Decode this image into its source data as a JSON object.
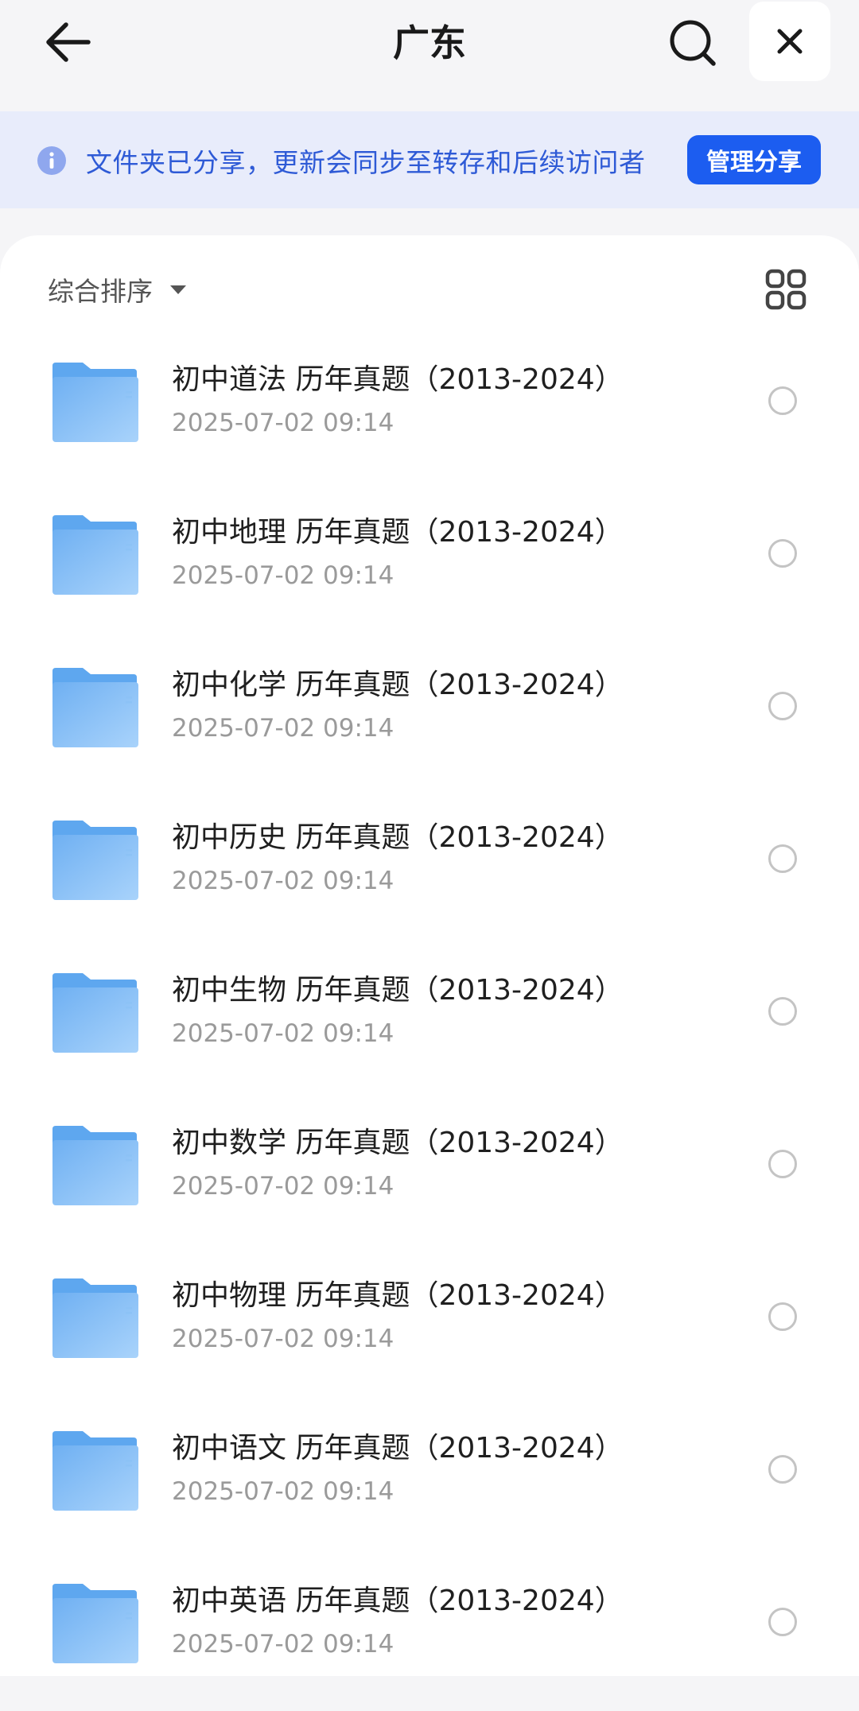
{
  "header": {
    "title": "广东",
    "back_icon": "arrow-left-icon",
    "search_icon": "search-icon",
    "close_icon": "close-icon"
  },
  "share_banner": {
    "icon": "info-icon",
    "message": "文件夹已分享，更新会同步至转存和后续访问者",
    "manage_button": "管理分享"
  },
  "toolbar": {
    "sort_label": "综合排序",
    "sort_icon": "caret-down-icon",
    "view_toggle_icon": "grid-view-icon"
  },
  "files": [
    {
      "name": "初中道法 历年真题（2013-2024）",
      "date": "2025-07-02 09:14",
      "icon": "folder-icon"
    },
    {
      "name": "初中地理 历年真题（2013-2024）",
      "date": "2025-07-02 09:14",
      "icon": "folder-icon"
    },
    {
      "name": "初中化学 历年真题（2013-2024）",
      "date": "2025-07-02 09:14",
      "icon": "folder-icon"
    },
    {
      "name": "初中历史 历年真题（2013-2024）",
      "date": "2025-07-02 09:14",
      "icon": "folder-icon"
    },
    {
      "name": "初中生物 历年真题（2013-2024）",
      "date": "2025-07-02 09:14",
      "icon": "folder-icon"
    },
    {
      "name": "初中数学 历年真题（2013-2024）",
      "date": "2025-07-02 09:14",
      "icon": "folder-icon"
    },
    {
      "name": "初中物理 历年真题（2013-2024）",
      "date": "2025-07-02 09:14",
      "icon": "folder-icon"
    },
    {
      "name": "初中语文 历年真题（2013-2024）",
      "date": "2025-07-02 09:14",
      "icon": "folder-icon"
    },
    {
      "name": "初中英语 历年真题（2013-2024）",
      "date": "2025-07-02 09:14",
      "icon": "folder-icon"
    }
  ],
  "colors": {
    "accent": "#1c5df0",
    "banner_bg": "#e8ecfb",
    "banner_text": "#2e5ad6",
    "folder": "#7ab8f5"
  }
}
